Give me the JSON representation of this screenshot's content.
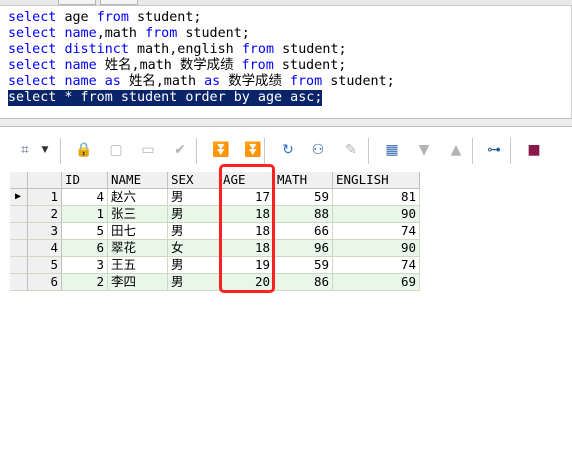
{
  "editor": {
    "lines": [
      [
        {
          "t": "select ",
          "k": true
        },
        {
          "t": "age ",
          "k": false
        },
        {
          "t": "from ",
          "k": true
        },
        {
          "t": "student;",
          "k": false
        }
      ],
      [
        {
          "t": "select ",
          "k": true
        },
        {
          "t": "name",
          "k": true
        },
        {
          "t": ",math ",
          "k": false
        },
        {
          "t": "from ",
          "k": true
        },
        {
          "t": "student;",
          "k": false
        }
      ],
      [
        {
          "t": "select ",
          "k": true
        },
        {
          "t": "distinct ",
          "k": true
        },
        {
          "t": "math,english ",
          "k": false
        },
        {
          "t": "from ",
          "k": true
        },
        {
          "t": "student;",
          "k": false
        }
      ],
      [
        {
          "t": "select ",
          "k": true
        },
        {
          "t": "name ",
          "k": true
        },
        {
          "t": "姓名,math 数学成绩 ",
          "k": false
        },
        {
          "t": "from ",
          "k": true
        },
        {
          "t": "student;",
          "k": false
        }
      ],
      [
        {
          "t": "select ",
          "k": true
        },
        {
          "t": "name ",
          "k": true
        },
        {
          "t": "as ",
          "k": true
        },
        {
          "t": "姓名,math ",
          "k": false
        },
        {
          "t": "as ",
          "k": true
        },
        {
          "t": "数学成绩 ",
          "k": false
        },
        {
          "t": "from ",
          "k": true
        },
        {
          "t": "student;",
          "k": false
        }
      ],
      [
        {
          "t": "select * from student order by age asc;",
          "k": false
        }
      ]
    ],
    "selected_line": 5
  },
  "toolbar": {
    "buttons": [
      {
        "name": "grid-options-icon",
        "glyph": "⌗",
        "color": "#5a6a8a",
        "disabled": false
      },
      {
        "name": "dropdown-arrow-icon",
        "glyph": "▼",
        "color": "#333333",
        "disabled": false
      },
      {
        "name": "lock-icon",
        "glyph": "🔒",
        "color": "#c0282d",
        "disabled": false
      },
      {
        "name": "insert-record-icon",
        "glyph": "▢",
        "color": "#b4b4b4",
        "disabled": true
      },
      {
        "name": "delete-record-icon",
        "glyph": "▭",
        "color": "#b4b4b4",
        "disabled": true
      },
      {
        "name": "post-check-icon",
        "glyph": "✔",
        "color": "#b4b4b4",
        "disabled": true
      },
      {
        "name": "first-record-icon",
        "glyph": "⏬",
        "color": "#b4b4b4",
        "disabled": true
      },
      {
        "name": "last-record-icon",
        "glyph": "⏬",
        "color": "#b4b4b4",
        "disabled": true
      },
      {
        "name": "refresh-icon",
        "glyph": "↻",
        "color": "#2f6fc4",
        "disabled": false
      },
      {
        "name": "find-binoculars-icon",
        "glyph": "⚇",
        "color": "#2c5b9e",
        "disabled": false
      },
      {
        "name": "clear-eraser-icon",
        "glyph": "✎",
        "color": "#b4b4b4",
        "disabled": true
      },
      {
        "name": "calculator-icon",
        "glyph": "▦",
        "color": "#3a6bb5",
        "disabled": false
      },
      {
        "name": "move-down-icon",
        "glyph": "▼",
        "color": "#b4b4b4",
        "disabled": true
      },
      {
        "name": "move-up-icon",
        "glyph": "▲",
        "color": "#b4b4b4",
        "disabled": true
      },
      {
        "name": "tree-view-icon",
        "glyph": "⊶",
        "color": "#2c5b9e",
        "disabled": false
      },
      {
        "name": "save-icon",
        "glyph": "■",
        "color": "#8b1a4a",
        "disabled": false
      }
    ]
  },
  "grid": {
    "columns": [
      "ID",
      "NAME",
      "SEX",
      "AGE",
      "MATH",
      "ENGLISH"
    ],
    "rows": [
      {
        "rownum": "1",
        "ID": "4",
        "NAME": "赵六",
        "SEX": "男",
        "AGE": "17",
        "MATH": "59",
        "ENGLISH": "81",
        "current": true
      },
      {
        "rownum": "2",
        "ID": "1",
        "NAME": "张三",
        "SEX": "男",
        "AGE": "18",
        "MATH": "88",
        "ENGLISH": "90",
        "current": false
      },
      {
        "rownum": "3",
        "ID": "5",
        "NAME": "田七",
        "SEX": "男",
        "AGE": "18",
        "MATH": "66",
        "ENGLISH": "74",
        "current": false
      },
      {
        "rownum": "4",
        "ID": "6",
        "NAME": "翠花",
        "SEX": "女",
        "AGE": "18",
        "MATH": "96",
        "ENGLISH": "90",
        "current": false
      },
      {
        "rownum": "5",
        "ID": "3",
        "NAME": "王五",
        "SEX": "男",
        "AGE": "19",
        "MATH": "59",
        "ENGLISH": "74",
        "current": false
      },
      {
        "rownum": "6",
        "ID": "2",
        "NAME": "李四",
        "SEX": "男",
        "AGE": "20",
        "MATH": "86",
        "ENGLISH": "69",
        "current": false
      }
    ],
    "current_row_marker": "▶",
    "highlight_color": "#ff2020"
  }
}
